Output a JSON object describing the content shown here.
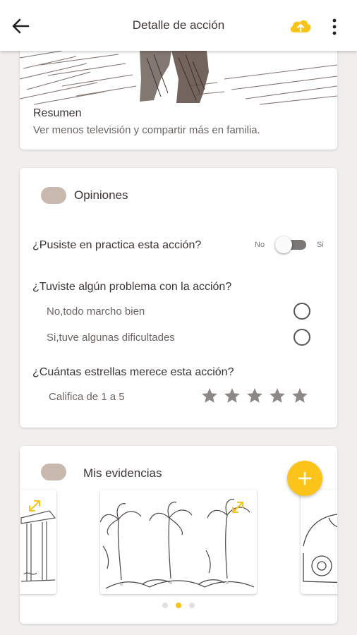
{
  "appbar": {
    "title": "Detalle de acción",
    "back_icon": "arrow-left-icon",
    "upload_icon": "cloud-upload-icon",
    "menu_icon": "more-vertical-icon"
  },
  "summary": {
    "title": "Resumen",
    "text": "Ver menos televisión y compartir más en familia."
  },
  "opinions": {
    "title": "Opiniones",
    "q1": {
      "label": "¿Pusiste en practica esta acción?",
      "switch_off": "No",
      "switch_on": "Si",
      "value": false
    },
    "q2": {
      "label": "¿Tuviste algún problema con la acción?",
      "options": [
        "No,todo marcho bien",
        "Si,tuve algunas dificultades"
      ]
    },
    "q3": {
      "label": "¿Cuántas estrellas merece esta acción?",
      "hint": "Califica de 1 a 5",
      "rating": 0,
      "max": 5
    }
  },
  "evidences": {
    "title": "Mis evidencias",
    "fab_icon": "plus-icon",
    "expand_icon": "expand-arrows-icon",
    "pages": 3,
    "active_page": 1
  },
  "colors": {
    "accent": "#fcc41a",
    "pill": "#c9b8ad",
    "background": "#f1efed",
    "star": "#8c8885"
  }
}
